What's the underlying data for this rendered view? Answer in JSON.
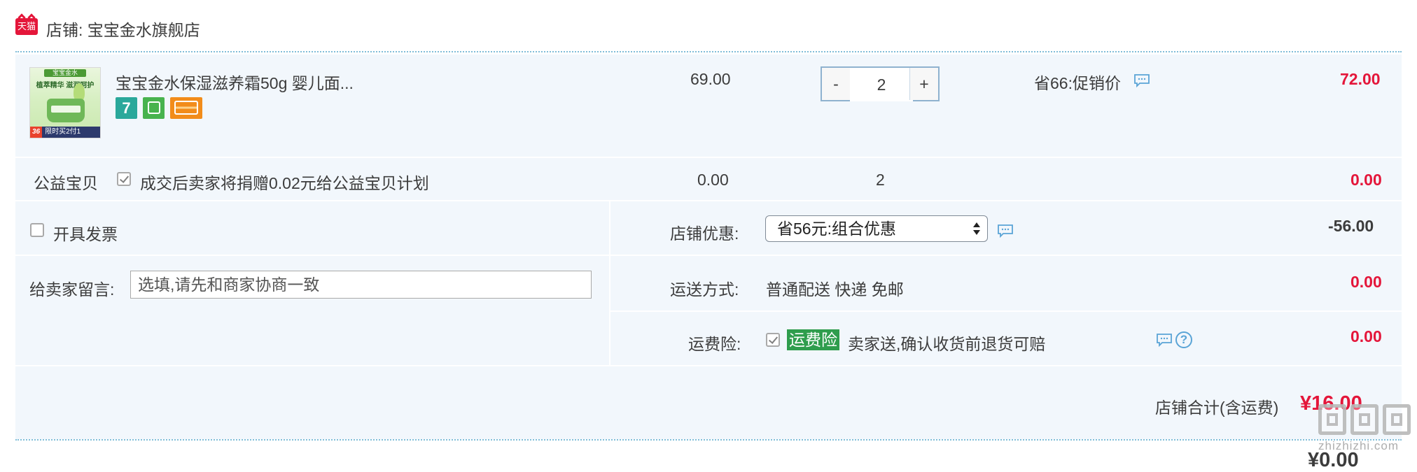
{
  "shop": {
    "badge": "天猫",
    "name": "店铺: 宝宝金水旗舰店"
  },
  "product": {
    "image": {
      "brand": "宝宝金水",
      "headline": "植萃精华 滋润呵护",
      "promo_number": "36",
      "promo_text": "限时买2付1"
    },
    "title": "宝宝金水保湿滋养霜50g 婴儿面...",
    "service_icons": [
      "seven-day-return-icon",
      "shopping-bag-icon",
      "credit-card-icon"
    ],
    "service_icon_7": "7",
    "unit_price": "69.00",
    "quantity": "2",
    "minus": "-",
    "plus": "+",
    "discount": "省66:促销价",
    "subtotal": "72.00"
  },
  "charity": {
    "label": "公益宝贝",
    "text": "成交后卖家将捐赠0.02元给公益宝贝计划",
    "price": "0.00",
    "quantity": "2",
    "subtotal": "0.00"
  },
  "invoice": {
    "label": "开具发票"
  },
  "message": {
    "label": "给卖家留言:",
    "placeholder": "选填,请先和商家协商一致"
  },
  "shop_discount": {
    "label": "店铺优惠:",
    "selected": "省56元:组合优惠",
    "amount": "-56.00"
  },
  "shipping": {
    "label": "运送方式:",
    "value": "普通配送 快递 免邮",
    "amount": "0.00"
  },
  "insurance": {
    "label": "运费险:",
    "tag": "运费险",
    "text": "卖家送,确认收货前退货可赔",
    "amount": "0.00",
    "help": "?"
  },
  "total": {
    "label": "店铺合计(含运费)",
    "amount": "¥16.00"
  },
  "watermark": {
    "text": "zhizhizhi.com"
  },
  "next_amount": "¥0.00",
  "colors": {
    "accent_red": "#e4163a",
    "panel_bg": "#f2f7fc",
    "green_tag": "#2f9d4d",
    "link_blue": "#5aa4d6"
  }
}
